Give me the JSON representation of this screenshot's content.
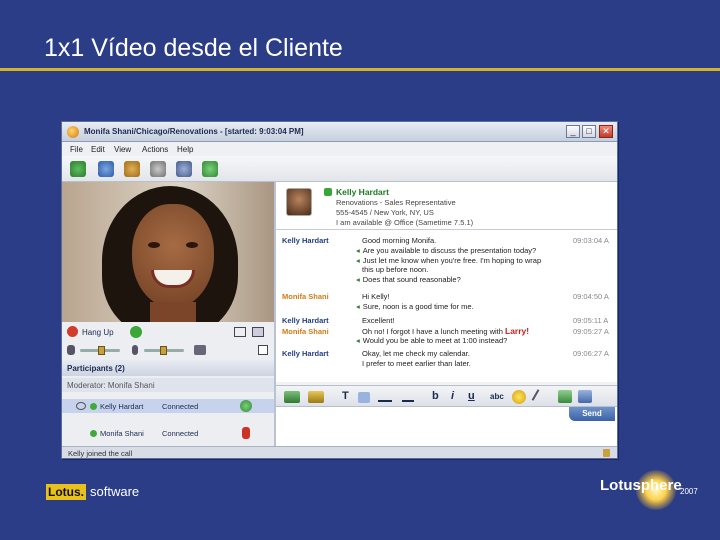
{
  "slide": {
    "title": "1x1 Vídeo desde el Cliente",
    "footer_left_brand": "Lotus.",
    "footer_left_product": "software",
    "footer_right_brand": "Lotusphere",
    "footer_right_year": "2007"
  },
  "window": {
    "title": "Monifa Shani/Chicago/Renovations - [started: 9:03:04 PM]",
    "controls": {
      "minimize": "_",
      "maximize": "□",
      "close": "✕"
    }
  },
  "menubar": {
    "items": [
      "File",
      "Edit",
      "View",
      "Actions",
      "Help"
    ]
  },
  "toolbar": {
    "icons": [
      "add-people-icon",
      "invite-icon",
      "meeting-icon",
      "call-icon",
      "video-icon",
      "share-icon"
    ]
  },
  "side_panel": {
    "hang_up_label": "Hang Up",
    "participants_header": "Participants (2)",
    "moderator": "Moderator: Monifa Shani",
    "participants": [
      {
        "name": "Kelly Hardart",
        "status": "Connected"
      },
      {
        "name": "Monifa Shani",
        "status": "Connected"
      }
    ]
  },
  "contact": {
    "name": "Kelly Hardart",
    "title": "Renovations - Sales Representative",
    "phone_location": "555-4545 / New York, NY, US",
    "availability": "I am available @ Office (Sametime 7.5.1)"
  },
  "chat": {
    "messages": [
      {
        "sender": "Kelly Hardart",
        "me": false,
        "lines": [
          "Good morning Monifa.",
          "Are you available to discuss the presentation today?",
          "Just let me know when you're free. I'm hoping to wrap",
          "this up before noon.",
          "Does that sound reasonable?"
        ],
        "bullets": [
          false,
          true,
          true,
          false,
          true
        ],
        "time": "09:03:04 A"
      },
      {
        "sender": "Monifa Shani",
        "me": true,
        "lines": [
          "Hi Kelly!",
          "Sure, noon is a good time for me."
        ],
        "bullets": [
          false,
          true
        ],
        "time": "09:04:50 A"
      },
      {
        "sender": "Kelly Hardart",
        "me": false,
        "lines": [
          "Excellent!"
        ],
        "bullets": [
          false
        ],
        "time": "09:05:11 A"
      },
      {
        "sender": "Monifa Shani",
        "me": true,
        "lines": [
          "Oh no! I forgot I have a lunch meeting with",
          "Would you be able to meet at 1:00 instead?"
        ],
        "bullets": [
          false,
          true
        ],
        "highlight": "Larry!",
        "time": "09:05:27 A"
      },
      {
        "sender": "Kelly Hardart",
        "me": false,
        "lines": [
          "Okay, let me check my calendar.",
          "I prefer to meet earlier than later."
        ],
        "bullets": [
          false,
          false
        ],
        "time": "09:06:27 A"
      }
    ]
  },
  "format_bar": {
    "font_color": "T",
    "bold": "b",
    "italic": "i",
    "underline": "u",
    "spell": "abc"
  },
  "compose": {
    "send_label": "Send"
  },
  "statusbar": {
    "text": "Kelly joined the call"
  }
}
